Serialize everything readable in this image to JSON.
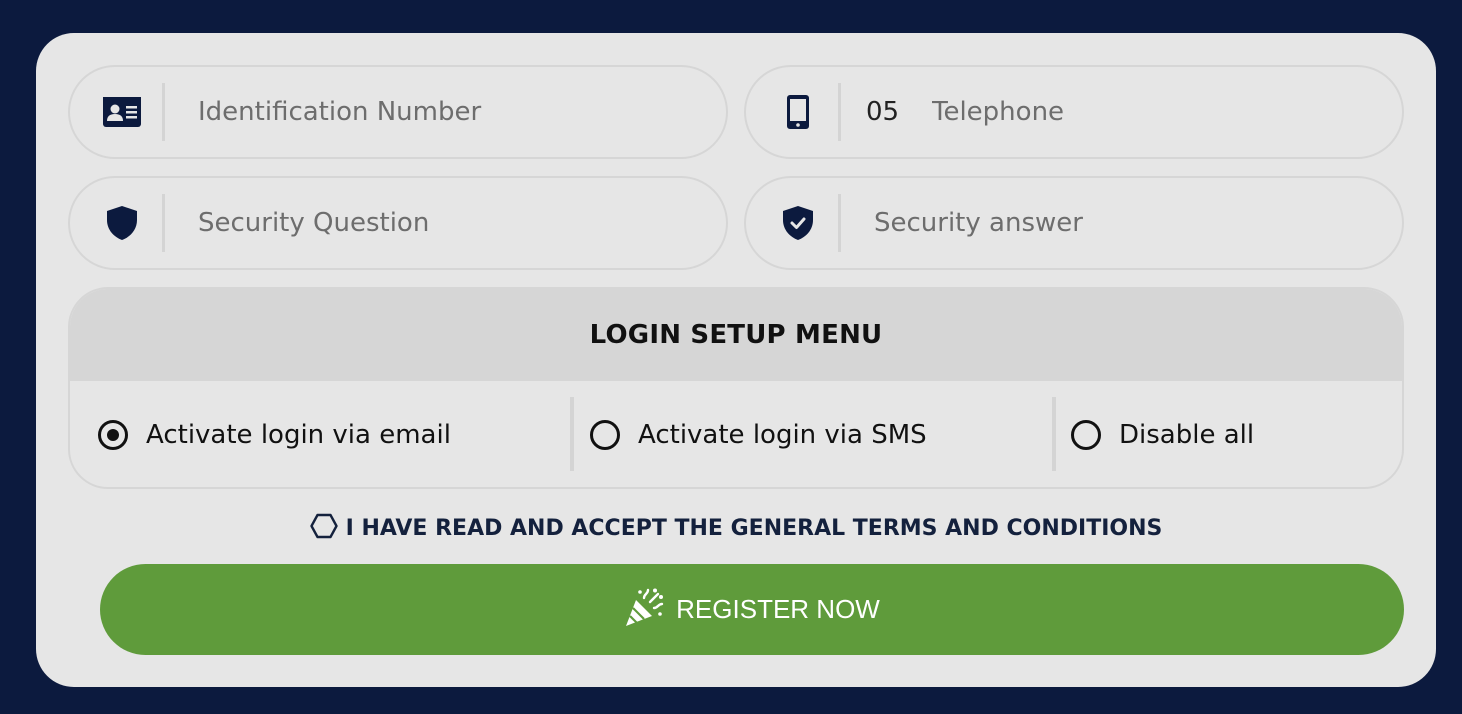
{
  "form": {
    "identification": {
      "placeholder": "Identification Number",
      "value": "",
      "icon": "id-card-icon"
    },
    "telephone": {
      "prefix": "05",
      "placeholder": "Telephone",
      "value": "",
      "icon": "mobile-phone-icon"
    },
    "security_question": {
      "placeholder": "Security Question",
      "value": "",
      "icon": "shield-icon"
    },
    "security_answer": {
      "placeholder": "Security answer",
      "value": "",
      "icon": "shield-check-icon"
    }
  },
  "login_menu": {
    "title": "LOGIN SETUP MENU",
    "options": [
      {
        "label": "Activate login via email",
        "selected": true
      },
      {
        "label": "Activate login via SMS",
        "selected": false
      },
      {
        "label": "Disable all",
        "selected": false
      }
    ]
  },
  "terms": {
    "label": "I HAVE READ AND ACCEPT THE GENERAL TERMS AND CONDITIONS",
    "checked": false,
    "icon": "hexagon-checkbox-icon"
  },
  "register_button": {
    "label": "REGISTER NOW",
    "icon": "party-popper-icon"
  },
  "colors": {
    "page_background": "#0c1a3e",
    "card_background": "#e6e6e6",
    "register_button": "#5f9b3b",
    "icon_navy": "#0c1a3e"
  }
}
